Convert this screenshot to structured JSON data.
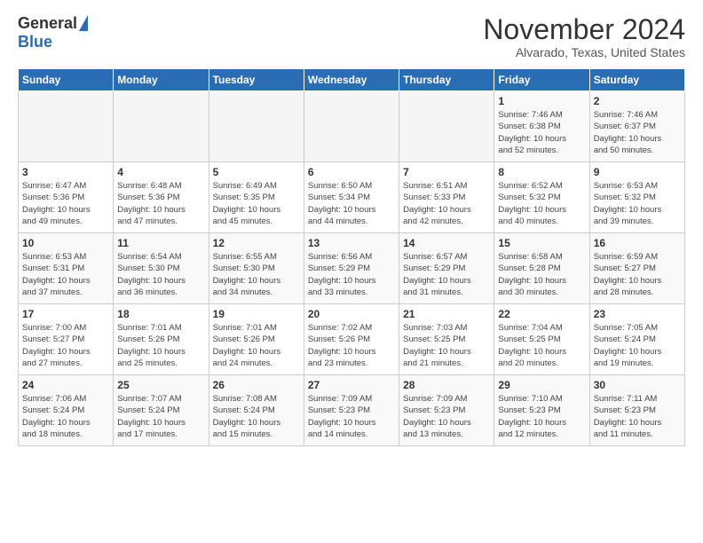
{
  "logo": {
    "general": "General",
    "blue": "Blue"
  },
  "header": {
    "month_title": "November 2024",
    "location": "Alvarado, Texas, United States"
  },
  "weekdays": [
    "Sunday",
    "Monday",
    "Tuesday",
    "Wednesday",
    "Thursday",
    "Friday",
    "Saturday"
  ],
  "weeks": [
    [
      {
        "day": "",
        "info": ""
      },
      {
        "day": "",
        "info": ""
      },
      {
        "day": "",
        "info": ""
      },
      {
        "day": "",
        "info": ""
      },
      {
        "day": "",
        "info": ""
      },
      {
        "day": "1",
        "info": "Sunrise: 7:46 AM\nSunset: 6:38 PM\nDaylight: 10 hours\nand 52 minutes."
      },
      {
        "day": "2",
        "info": "Sunrise: 7:46 AM\nSunset: 6:37 PM\nDaylight: 10 hours\nand 50 minutes."
      }
    ],
    [
      {
        "day": "3",
        "info": "Sunrise: 6:47 AM\nSunset: 5:36 PM\nDaylight: 10 hours\nand 49 minutes."
      },
      {
        "day": "4",
        "info": "Sunrise: 6:48 AM\nSunset: 5:36 PM\nDaylight: 10 hours\nand 47 minutes."
      },
      {
        "day": "5",
        "info": "Sunrise: 6:49 AM\nSunset: 5:35 PM\nDaylight: 10 hours\nand 45 minutes."
      },
      {
        "day": "6",
        "info": "Sunrise: 6:50 AM\nSunset: 5:34 PM\nDaylight: 10 hours\nand 44 minutes."
      },
      {
        "day": "7",
        "info": "Sunrise: 6:51 AM\nSunset: 5:33 PM\nDaylight: 10 hours\nand 42 minutes."
      },
      {
        "day": "8",
        "info": "Sunrise: 6:52 AM\nSunset: 5:32 PM\nDaylight: 10 hours\nand 40 minutes."
      },
      {
        "day": "9",
        "info": "Sunrise: 6:53 AM\nSunset: 5:32 PM\nDaylight: 10 hours\nand 39 minutes."
      }
    ],
    [
      {
        "day": "10",
        "info": "Sunrise: 6:53 AM\nSunset: 5:31 PM\nDaylight: 10 hours\nand 37 minutes."
      },
      {
        "day": "11",
        "info": "Sunrise: 6:54 AM\nSunset: 5:30 PM\nDaylight: 10 hours\nand 36 minutes."
      },
      {
        "day": "12",
        "info": "Sunrise: 6:55 AM\nSunset: 5:30 PM\nDaylight: 10 hours\nand 34 minutes."
      },
      {
        "day": "13",
        "info": "Sunrise: 6:56 AM\nSunset: 5:29 PM\nDaylight: 10 hours\nand 33 minutes."
      },
      {
        "day": "14",
        "info": "Sunrise: 6:57 AM\nSunset: 5:29 PM\nDaylight: 10 hours\nand 31 minutes."
      },
      {
        "day": "15",
        "info": "Sunrise: 6:58 AM\nSunset: 5:28 PM\nDaylight: 10 hours\nand 30 minutes."
      },
      {
        "day": "16",
        "info": "Sunrise: 6:59 AM\nSunset: 5:27 PM\nDaylight: 10 hours\nand 28 minutes."
      }
    ],
    [
      {
        "day": "17",
        "info": "Sunrise: 7:00 AM\nSunset: 5:27 PM\nDaylight: 10 hours\nand 27 minutes."
      },
      {
        "day": "18",
        "info": "Sunrise: 7:01 AM\nSunset: 5:26 PM\nDaylight: 10 hours\nand 25 minutes."
      },
      {
        "day": "19",
        "info": "Sunrise: 7:01 AM\nSunset: 5:26 PM\nDaylight: 10 hours\nand 24 minutes."
      },
      {
        "day": "20",
        "info": "Sunrise: 7:02 AM\nSunset: 5:26 PM\nDaylight: 10 hours\nand 23 minutes."
      },
      {
        "day": "21",
        "info": "Sunrise: 7:03 AM\nSunset: 5:25 PM\nDaylight: 10 hours\nand 21 minutes."
      },
      {
        "day": "22",
        "info": "Sunrise: 7:04 AM\nSunset: 5:25 PM\nDaylight: 10 hours\nand 20 minutes."
      },
      {
        "day": "23",
        "info": "Sunrise: 7:05 AM\nSunset: 5:24 PM\nDaylight: 10 hours\nand 19 minutes."
      }
    ],
    [
      {
        "day": "24",
        "info": "Sunrise: 7:06 AM\nSunset: 5:24 PM\nDaylight: 10 hours\nand 18 minutes."
      },
      {
        "day": "25",
        "info": "Sunrise: 7:07 AM\nSunset: 5:24 PM\nDaylight: 10 hours\nand 17 minutes."
      },
      {
        "day": "26",
        "info": "Sunrise: 7:08 AM\nSunset: 5:24 PM\nDaylight: 10 hours\nand 15 minutes."
      },
      {
        "day": "27",
        "info": "Sunrise: 7:09 AM\nSunset: 5:23 PM\nDaylight: 10 hours\nand 14 minutes."
      },
      {
        "day": "28",
        "info": "Sunrise: 7:09 AM\nSunset: 5:23 PM\nDaylight: 10 hours\nand 13 minutes."
      },
      {
        "day": "29",
        "info": "Sunrise: 7:10 AM\nSunset: 5:23 PM\nDaylight: 10 hours\nand 12 minutes."
      },
      {
        "day": "30",
        "info": "Sunrise: 7:11 AM\nSunset: 5:23 PM\nDaylight: 10 hours\nand 11 minutes."
      }
    ]
  ]
}
